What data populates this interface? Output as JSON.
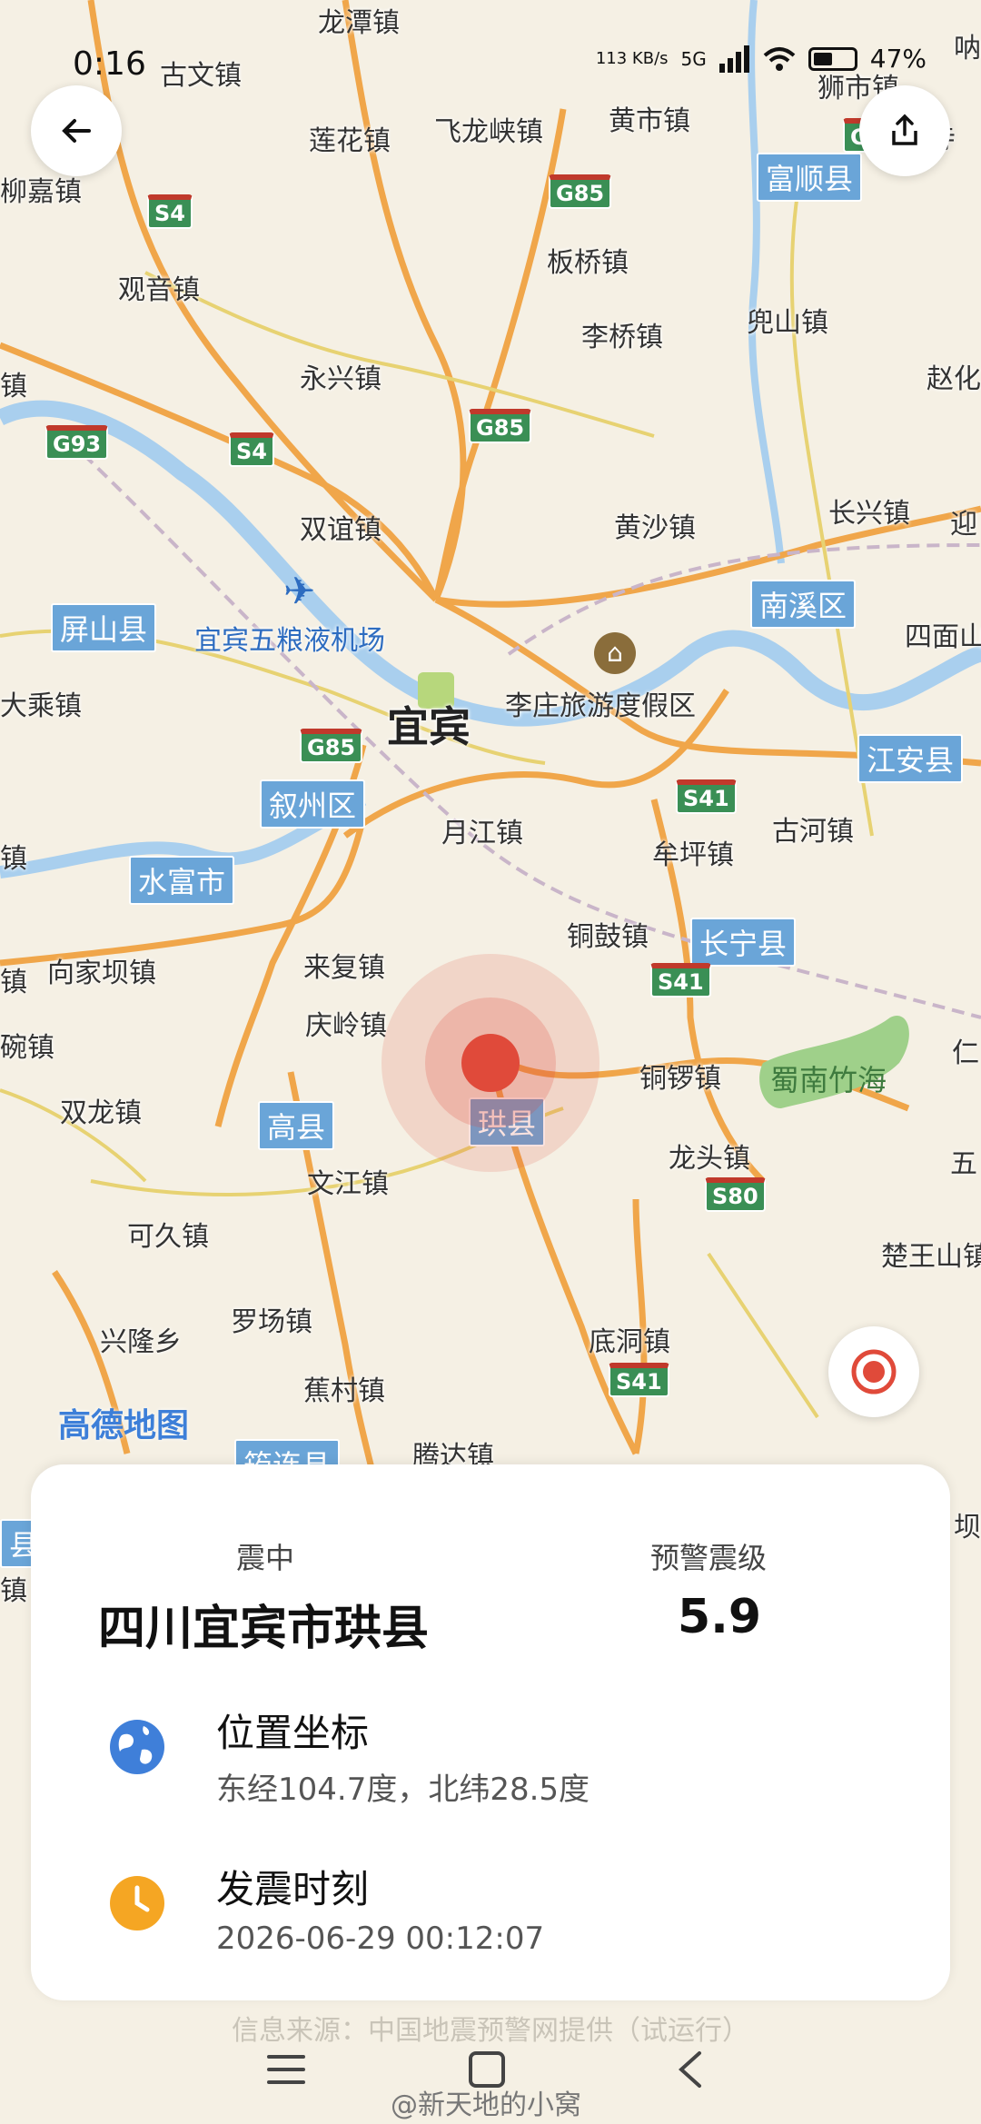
{
  "status_bar": {
    "time": "0:16",
    "speed": "113 KB/s",
    "network": "5G",
    "battery_percent": 47,
    "battery_text": "47%"
  },
  "map": {
    "labels": [
      {
        "text": "龙潭镇"
      },
      {
        "text": "古文镇"
      },
      {
        "text": "莲花镇"
      },
      {
        "text": "飞龙峡镇"
      },
      {
        "text": "黄市镇"
      },
      {
        "text": "狮市镇"
      },
      {
        "text": "柳嘉镇"
      },
      {
        "text": "板桥镇"
      },
      {
        "text": "观音镇"
      },
      {
        "text": "李桥镇"
      },
      {
        "text": "兜山镇"
      },
      {
        "text": "赵化"
      },
      {
        "text": "永兴镇"
      },
      {
        "text": "镇"
      },
      {
        "text": "双谊镇"
      },
      {
        "text": "黄沙镇"
      },
      {
        "text": "长兴镇"
      },
      {
        "text": "迎"
      },
      {
        "text": "四面山"
      },
      {
        "text": "大乘镇"
      },
      {
        "text": "李庄旅游度假区"
      },
      {
        "text": "月江镇"
      },
      {
        "text": "古河镇"
      },
      {
        "text": "牟坪镇"
      },
      {
        "text": "镇"
      },
      {
        "text": "铜鼓镇"
      },
      {
        "text": "向家坝镇"
      },
      {
        "text": "来复镇"
      },
      {
        "text": "镇"
      },
      {
        "text": "庆岭镇"
      },
      {
        "text": "铜锣镇"
      },
      {
        "text": "仁"
      },
      {
        "text": "碗镇"
      },
      {
        "text": "双龙镇"
      },
      {
        "text": "龙头镇"
      },
      {
        "text": "五"
      },
      {
        "text": "文江镇"
      },
      {
        "text": "可久镇"
      },
      {
        "text": "楚王山镇"
      },
      {
        "text": "罗场镇"
      },
      {
        "text": "兴隆乡"
      },
      {
        "text": "底洞镇"
      },
      {
        "text": "蕉村镇"
      },
      {
        "text": "腾达镇"
      },
      {
        "text": "坝"
      },
      {
        "text": "镇"
      },
      {
        "text": "宜宾五粮液机场"
      },
      {
        "text": "呐"
      },
      {
        "text": "代寺"
      }
    ],
    "city_label": "宜宾",
    "districts": [
      {
        "text": "富顺县"
      },
      {
        "text": "屏山县"
      },
      {
        "text": "南溪区"
      },
      {
        "text": "江安县"
      },
      {
        "text": "叙州区"
      },
      {
        "text": "水富市"
      },
      {
        "text": "长宁县"
      },
      {
        "text": "高县"
      },
      {
        "text": "珙县"
      },
      {
        "text": "筠连县"
      },
      {
        "text": "县"
      }
    ],
    "highways": [
      "G85",
      "S4",
      "G93",
      "S4",
      "G85",
      "G85",
      "S41",
      "S41",
      "S80",
      "S41",
      "G"
    ],
    "scenic": "蜀南竹海",
    "logo": "高德地图",
    "epicenter_color": "#e04a3a"
  },
  "card": {
    "epicenter_label": "震中",
    "epicenter_value": "四川宜宾市珙县",
    "magnitude_label": "预警震级",
    "magnitude_value": "5.9",
    "coords_title": "位置坐标",
    "coords_value": "东经104.7度，北纬28.5度",
    "time_title": "发震时刻",
    "time_value": "2026-06-29 00:12:07"
  },
  "source_text": "信息来源：中国地震预警网提供（试运行）",
  "watermark": "@新天地的小窝",
  "colors": {
    "accent_blue": "#3f7fd9",
    "clock_orange": "#f5a623",
    "epicenter": "#e04a3a"
  }
}
